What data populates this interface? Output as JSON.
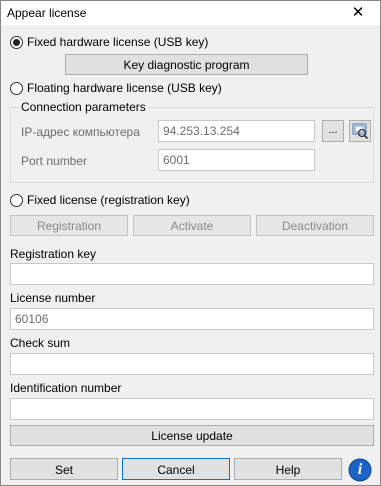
{
  "window": {
    "title": "Appear license",
    "close_glyph": "✕"
  },
  "options": {
    "usb": "Fixed hardware license (USB key)",
    "key_diag_button": "Key diagnostic program",
    "floating": "Floating hardware license (USB key)",
    "conn_group_title": "Connection parameters",
    "ip_label": "IP-адрес компьютера",
    "ip_value": "94.253.13.254",
    "browse_glyph": "...",
    "port_label": "Port number",
    "port_value": "6001",
    "fixed_reg": "Fixed license (registration key)"
  },
  "reg_buttons": {
    "registration": "Registration",
    "activate": "Activate",
    "deactivation": "Deactivation"
  },
  "fields": {
    "reg_key_label": "Registration key",
    "reg_key_value": "",
    "license_number_label": "License number",
    "license_number_value": "60106",
    "check_sum_label": "Check sum",
    "check_sum_value": "",
    "id_number_label": "Identification number",
    "id_number_value": ""
  },
  "license_update_button": "License update",
  "footer": {
    "set": "Set",
    "cancel": "Cancel",
    "help": "Help",
    "info_glyph": "i"
  },
  "colors": {
    "accent": "#0078d7",
    "info_icon": "#1e64c8"
  }
}
